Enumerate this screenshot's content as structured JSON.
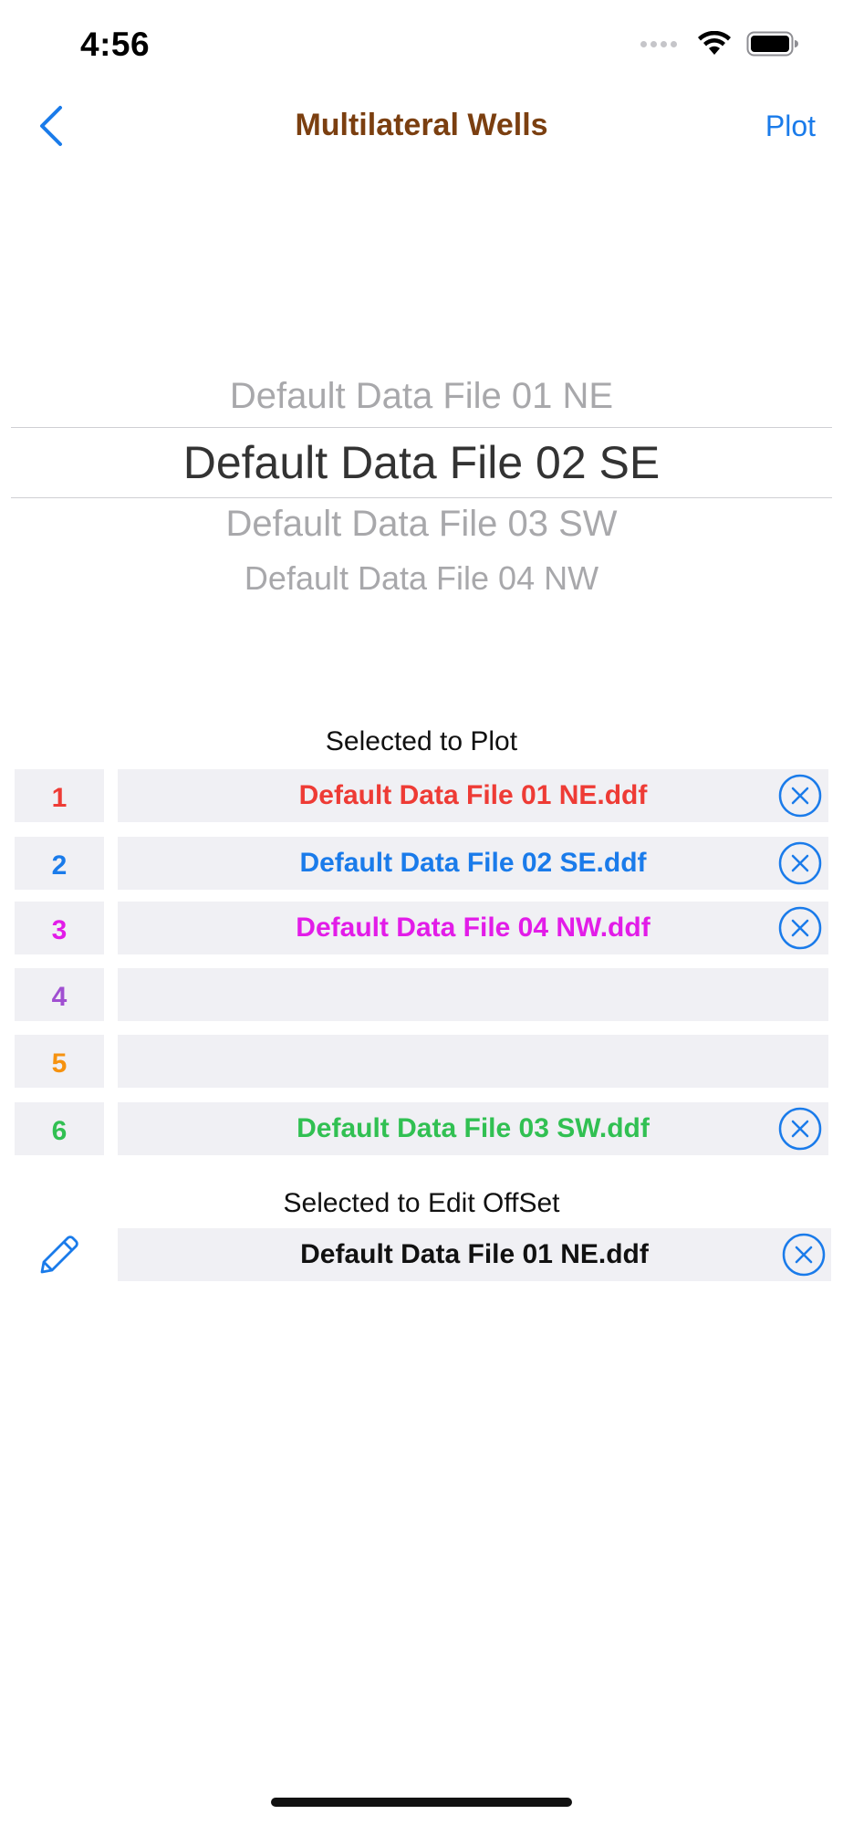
{
  "status_bar": {
    "time": "4:56"
  },
  "nav": {
    "title": "Multilateral Wells",
    "plot_label": "Plot",
    "back_icon": "chevron-left-icon",
    "title_color": "#7b3f10",
    "accent_color": "#1a7bea"
  },
  "picker": {
    "items": [
      "Default Data File 01 NE",
      "Default Data File 02 SE",
      "Default Data File 03 SW",
      "Default Data File 04 NW"
    ],
    "selected": "Default Data File 02 SE"
  },
  "plot_section": {
    "label": "Selected to Plot",
    "slots": [
      {
        "number": "1",
        "file": "Default Data File 01 NE.ddf",
        "color": "#ee3b35",
        "has_clear": true
      },
      {
        "number": "2",
        "file": "Default Data File 02 SE.ddf",
        "color": "#1a7bea",
        "has_clear": true
      },
      {
        "number": "3",
        "file": "Default Data File 04 NW.ddf",
        "color": "#e21ce8",
        "has_clear": true
      },
      {
        "number": "4",
        "file": "",
        "color": "#a04fd1",
        "has_clear": false
      },
      {
        "number": "5",
        "file": "",
        "color": "#f6920f",
        "has_clear": false
      },
      {
        "number": "6",
        "file": "Default Data File 03 SW.ddf",
        "color": "#31c052",
        "has_clear": true
      }
    ]
  },
  "edit_section": {
    "label": "Selected to Edit OffSet",
    "file": "Default Data File 01 NE.ddf",
    "edit_icon": "pencil-icon",
    "clear_icon": "clear-circle-icon"
  }
}
